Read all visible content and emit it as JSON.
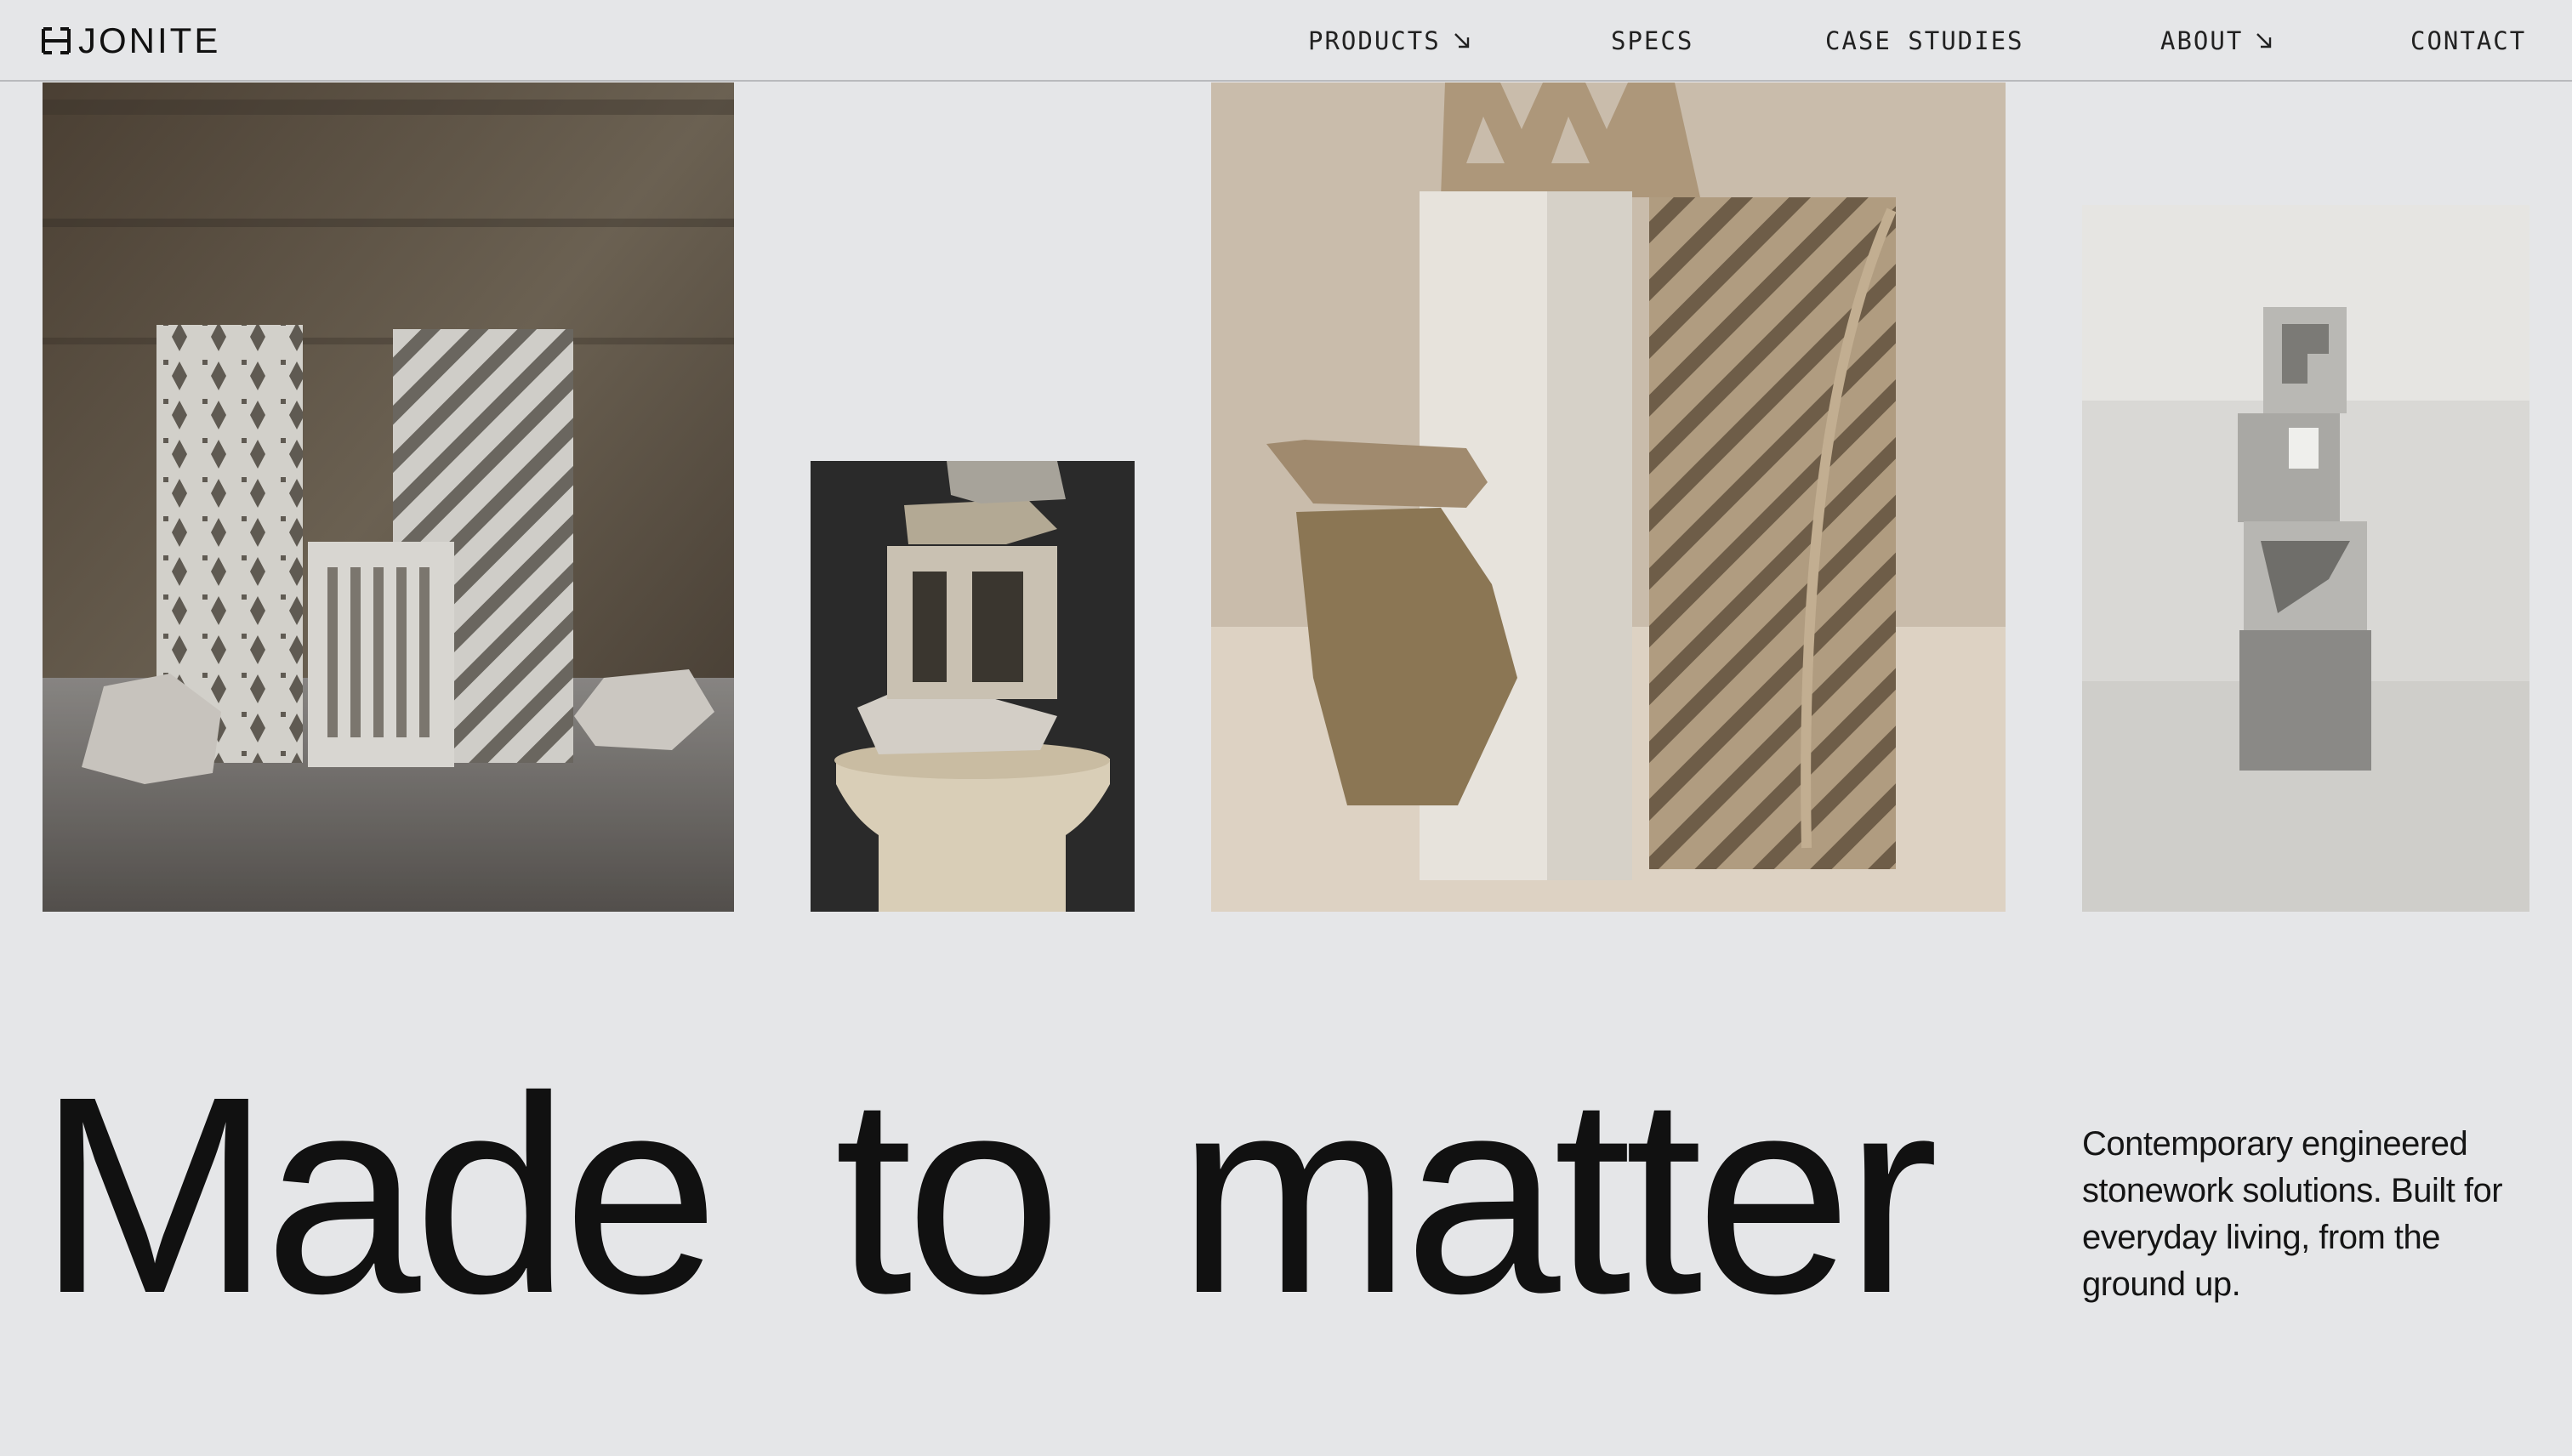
{
  "brand": {
    "name": "JONITE",
    "logo_icon": "jonite-logo-mark"
  },
  "nav": {
    "items": [
      {
        "label": "PRODUCTS",
        "has_arrow": true,
        "icon": "arrow-down-right-icon"
      },
      {
        "label": "SPECS",
        "has_arrow": false
      },
      {
        "label": "CASE STUDIES",
        "has_arrow": false
      },
      {
        "label": "ABOUT",
        "has_arrow": true,
        "icon": "arrow-down-right-icon"
      },
      {
        "label": "CONTACT",
        "has_arrow": false
      }
    ]
  },
  "gallery": [
    {
      "name": "patterned-stone-panels-photo"
    },
    {
      "name": "stacked-stone-block-photo"
    },
    {
      "name": "stone-pillar-leaf-panel-photo"
    },
    {
      "name": "stacked-breeze-blocks-photo"
    }
  ],
  "hero": {
    "headline": "Made to matter",
    "tagline": "Contemporary engineered stonework solutions. Built for everyday living, from the ground up."
  },
  "colors": {
    "background": "#e5e6e8",
    "text": "#111111",
    "divider": "#b9babd"
  }
}
